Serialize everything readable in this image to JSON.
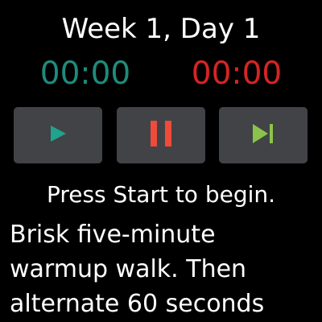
{
  "title": "Week 1, Day 1",
  "timers": {
    "elapsed": "00:00",
    "remaining": "00:00"
  },
  "controls": {
    "play_icon": "play-icon",
    "pause_icon": "pause-icon",
    "skip_icon": "skip-next-icon"
  },
  "status": "Press Start to begin.",
  "description": "Brisk five-minute warmup walk. Then alternate 60 seconds",
  "colors": {
    "background": "#000000",
    "button_bg": "#414346",
    "elapsed_timer": "#1f8b7c",
    "remaining_timer": "#d72424",
    "play": "#20a38f",
    "pause": "#f04a3a",
    "skip": "#8bc34a",
    "text": "#ffffff"
  }
}
